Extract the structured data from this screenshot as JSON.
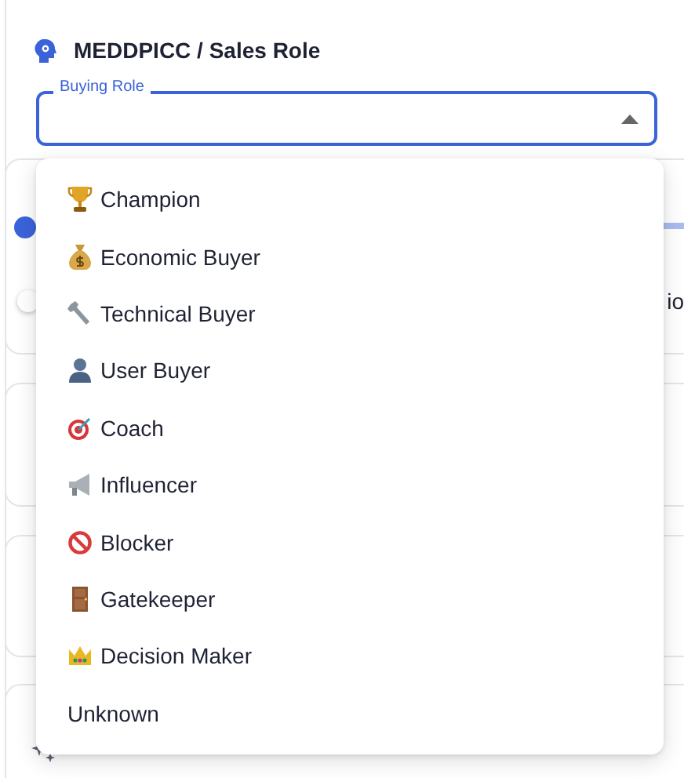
{
  "section": {
    "title": "MEDDPICC / Sales Role"
  },
  "buying_role": {
    "label": "Buying Role",
    "expanded": true,
    "options": [
      {
        "label": "Champion",
        "icon": true,
        "selected": false
      },
      {
        "label": "Economic Buyer",
        "icon": true,
        "selected": false
      },
      {
        "label": "Technical Buyer",
        "icon": true,
        "selected": false
      },
      {
        "label": "User Buyer",
        "icon": true,
        "selected": false
      },
      {
        "label": "Coach",
        "icon": true,
        "selected": false
      },
      {
        "label": "Influencer",
        "icon": true,
        "selected": false
      },
      {
        "label": "Blocker",
        "icon": true,
        "selected": false
      },
      {
        "label": "Gatekeeper",
        "icon": true,
        "selected": false
      },
      {
        "label": "Decision Maker",
        "icon": true,
        "selected": false
      },
      {
        "label": "Unknown",
        "icon": false,
        "selected": false
      }
    ]
  },
  "background": {
    "cut_text": "io",
    "toggle": {
      "on": false
    }
  }
}
